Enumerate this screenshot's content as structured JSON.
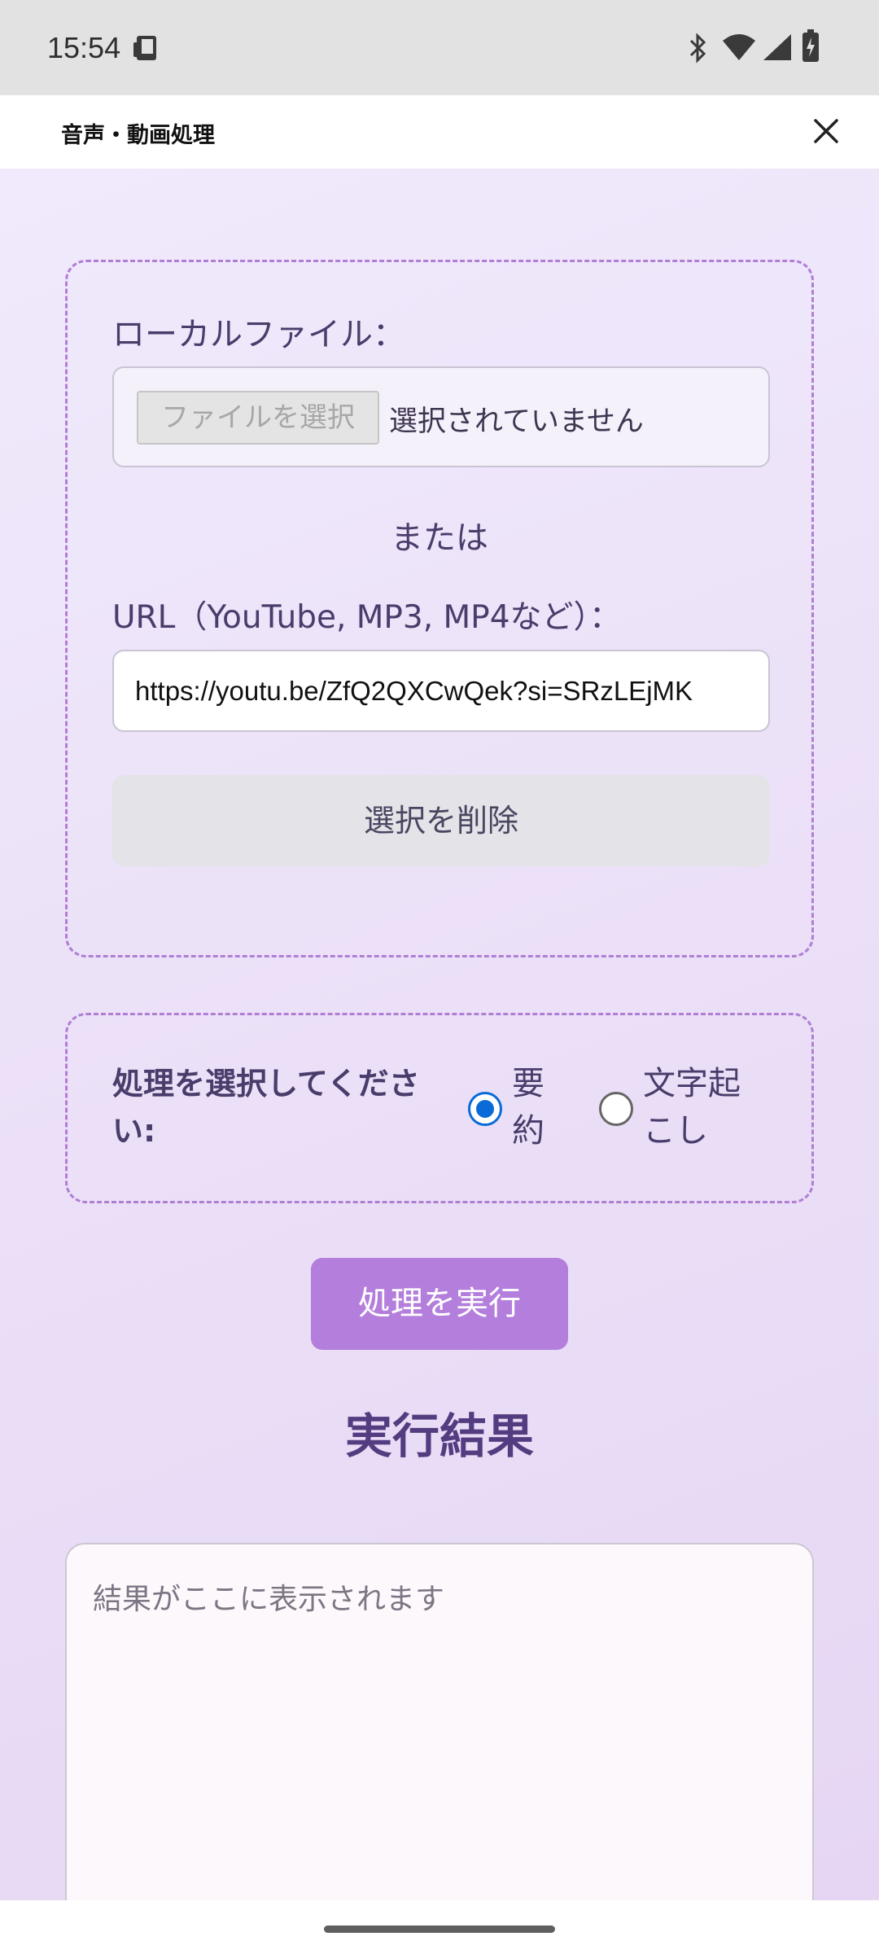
{
  "status_bar": {
    "time": "15:54"
  },
  "app_bar": {
    "title": "音声・動画処理"
  },
  "input_section": {
    "local_file_label": "ローカルファイル：",
    "file_button_label": "ファイルを選択",
    "file_status": "選択されていません",
    "or_label": "または",
    "url_label": "URL（YouTube, MP3, MP4など）：",
    "url_value": "https://youtu.be/ZfQ2QXCwQek?si=SRzLEjMK",
    "clear_button_label": "選択を削除"
  },
  "process_section": {
    "label": "処理を選択してください:",
    "options": [
      {
        "label": "要約",
        "selected": true
      },
      {
        "label": "文字起こし",
        "selected": false
      }
    ]
  },
  "run_button_label": "処理を実行",
  "result": {
    "title": "実行結果",
    "placeholder": "結果がここに表示されます"
  },
  "colors": {
    "accent": "#b47edc",
    "radio_selected": "#0a6bd8",
    "dashed_border": "#b07ed6",
    "heading": "#533d80"
  }
}
